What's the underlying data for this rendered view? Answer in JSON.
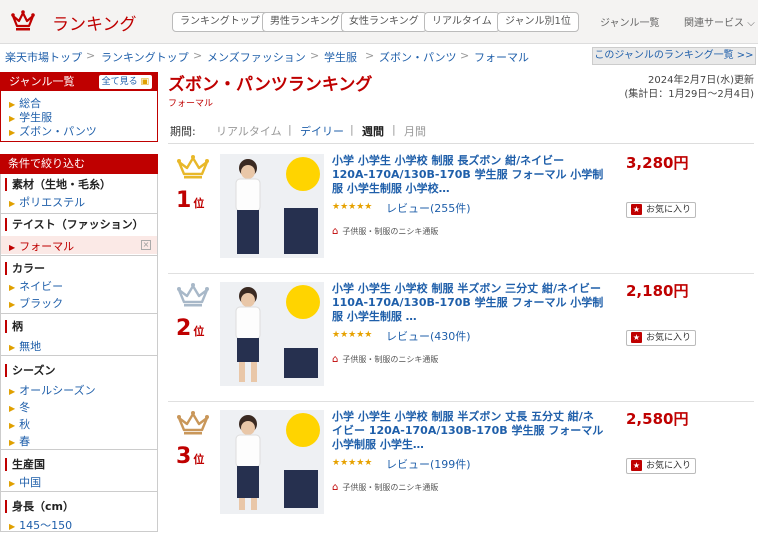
{
  "header": {
    "logo_text": "ランキング",
    "nav": [
      "ランキングトップ",
      "男性ランキング",
      "女性ランキング",
      "リアルタイム",
      "ジャンル別1位"
    ],
    "genre_list_link": "ジャンル一覧",
    "related_services": "関連サービス"
  },
  "breadcrumb": {
    "items": [
      "楽天市場トップ",
      "ランキングトップ",
      "メンズファッション",
      "学生服",
      "ズボン・パンツ",
      "フォーマル"
    ],
    "separator": ">",
    "other_ranking_link": "このジャンルのランキング一覧 >>"
  },
  "sidebar": {
    "genre_title": "ジャンル一覧",
    "view_all": "全て見る",
    "genre_items": [
      "総合",
      "学生服",
      "ズボン・パンツ"
    ],
    "filter_title": "条件で絞り込む",
    "sections": [
      {
        "title": "素材（生地・毛糸）",
        "items": [
          "ポリエステル"
        ]
      },
      {
        "title": "テイスト（ファッション）",
        "items": [
          "フォーマル"
        ],
        "selected": "フォーマル"
      },
      {
        "title": "カラー",
        "items": [
          "ネイビー",
          "ブラック"
        ]
      },
      {
        "title": "柄",
        "items": [
          "無地"
        ]
      },
      {
        "title": "シーズン",
        "items": [
          "オールシーズン",
          "冬",
          "秋",
          "春"
        ]
      },
      {
        "title": "生産国",
        "items": [
          "中国"
        ]
      },
      {
        "title": "身長（cm）",
        "items": [
          "145～150"
        ]
      }
    ],
    "close_mark": "×"
  },
  "main": {
    "title": "ズボン・パンツランキング",
    "subtitle": "フォーマル",
    "updated": "2024年2月7日(水)更新",
    "tally_period": "(集計日：1月29日～2月4日)",
    "period_label": "期間:",
    "periods": [
      "リアルタイム",
      "デイリー",
      "週間",
      "月間"
    ],
    "active_period": "週間",
    "period_separator": "|"
  },
  "products": [
    {
      "rank": "1",
      "rank_suffix": "位",
      "name": "小学 小学生 小学校 制服 長ズボン 紺/ネイビー 120A-170A/130B-170B 学生服 フォーマル 小学制服 小学生制服 小学校…",
      "price": "3,280円",
      "rating": 4.5,
      "stars": "★★★★★",
      "reviews": "レビュー(255件)",
      "shop": "子供服・制服のニシキ通販",
      "favorite": "お気に入り",
      "crown_color": "#e8b82a",
      "thumb_badge": "97%以上のお客様から高評価"
    },
    {
      "rank": "2",
      "rank_suffix": "位",
      "name": "小学 小学生 小学校 制服 半ズボン 三分丈 紺/ネイビー 110A-170A/130B-170B 学生服 フォーマル 小学制服 小学生制服 …",
      "price": "2,180円",
      "rating": 4.5,
      "stars": "★★★★★",
      "reviews": "レビュー(430件)",
      "shop": "子供服・制服のニシキ通販",
      "favorite": "お気に入り",
      "crown_color": "#a8b8c8",
      "thumb_badge": "97%以上のお客様から高評価"
    },
    {
      "rank": "3",
      "rank_suffix": "位",
      "name": "小学 小学生 小学校 制服 半ズボン 丈長 五分丈 紺/ネイビー 120A-170A/130B-170B 学生服 フォーマル 小学制服 小学生…",
      "price": "2,580円",
      "rating": 4.5,
      "stars": "★★★★★",
      "reviews": "レビュー(199件)",
      "shop": "子供服・制服のニシキ通販",
      "favorite": "お気に入り",
      "crown_color": "#c9975a",
      "thumb_badge": "97%以上のお客様から高評価"
    }
  ],
  "colors": {
    "brand": "#bf0000",
    "link": "#1f5faa",
    "star": "#e6a100"
  }
}
